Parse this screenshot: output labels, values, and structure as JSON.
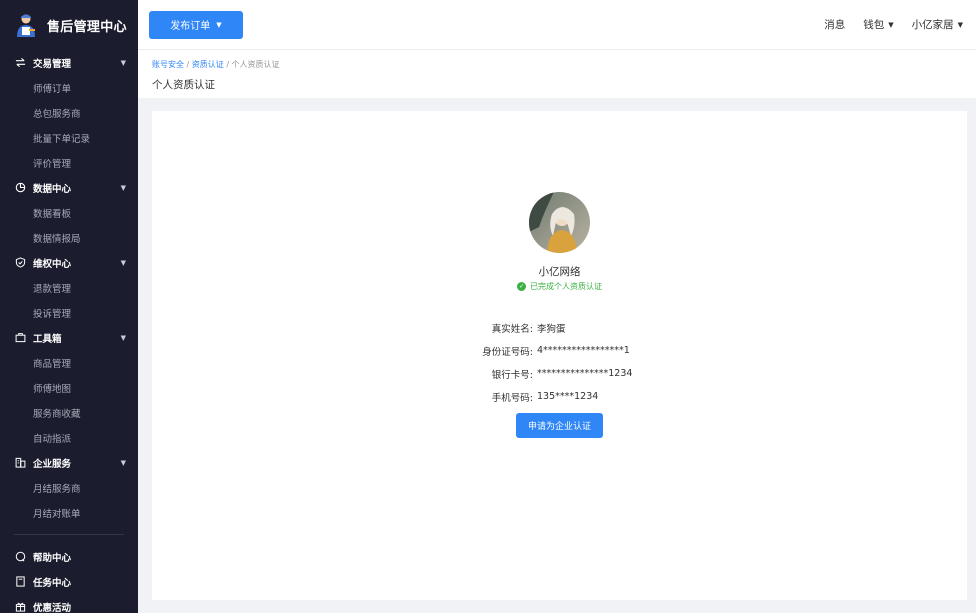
{
  "brand": {
    "title": "售后管理中心",
    "logo": "technician-logo"
  },
  "sidebar": {
    "groups": [
      {
        "label": "交易管理",
        "icon": "swap-icon",
        "items": [
          {
            "label": "师傅订单"
          },
          {
            "label": "总包服务商"
          },
          {
            "label": "批量下单记录"
          },
          {
            "label": "评价管理"
          }
        ]
      },
      {
        "label": "数据中心",
        "icon": "pie-chart-icon",
        "items": [
          {
            "label": "数据看板"
          },
          {
            "label": "数据情报局"
          }
        ]
      },
      {
        "label": "维权中心",
        "icon": "shield-check-icon",
        "items": [
          {
            "label": "退款管理"
          },
          {
            "label": "投诉管理"
          }
        ]
      },
      {
        "label": "工具箱",
        "icon": "toolbox-icon",
        "items": [
          {
            "label": "商品管理"
          },
          {
            "label": "师傅地图"
          },
          {
            "label": "服务商收藏"
          },
          {
            "label": "自动指派"
          }
        ]
      },
      {
        "label": "企业服务",
        "icon": "building-icon",
        "items": [
          {
            "label": "月结服务商"
          },
          {
            "label": "月结对账单"
          }
        ]
      }
    ],
    "bottom": [
      {
        "label": "帮助中心",
        "icon": "help-icon"
      },
      {
        "label": "任务中心",
        "icon": "task-icon"
      },
      {
        "label": "优惠活动",
        "icon": "gift-icon"
      }
    ]
  },
  "topbar": {
    "publish_label": "发布订单",
    "messages": "消息",
    "wallet": "钱包",
    "user": "小亿家居"
  },
  "breadcrumb": {
    "items": [
      "账号安全",
      "资质认证",
      "个人资质认证"
    ],
    "sep": " / "
  },
  "page_title": "个人资质认证",
  "profile": {
    "name": "小亿网络",
    "status": "已完成个人资质认证",
    "fields": [
      {
        "label": "真实姓名:",
        "value": "李狗蛋"
      },
      {
        "label": "身份证号码:",
        "value": "4*****************1"
      },
      {
        "label": "银行卡号:",
        "value": "***************1234"
      },
      {
        "label": "手机号码:",
        "value": "135****1234"
      }
    ],
    "action_label": "申请为企业认证"
  },
  "colors": {
    "primary": "#2f86f6",
    "sidebar": "#1b1d2e",
    "success": "#3bb143"
  }
}
